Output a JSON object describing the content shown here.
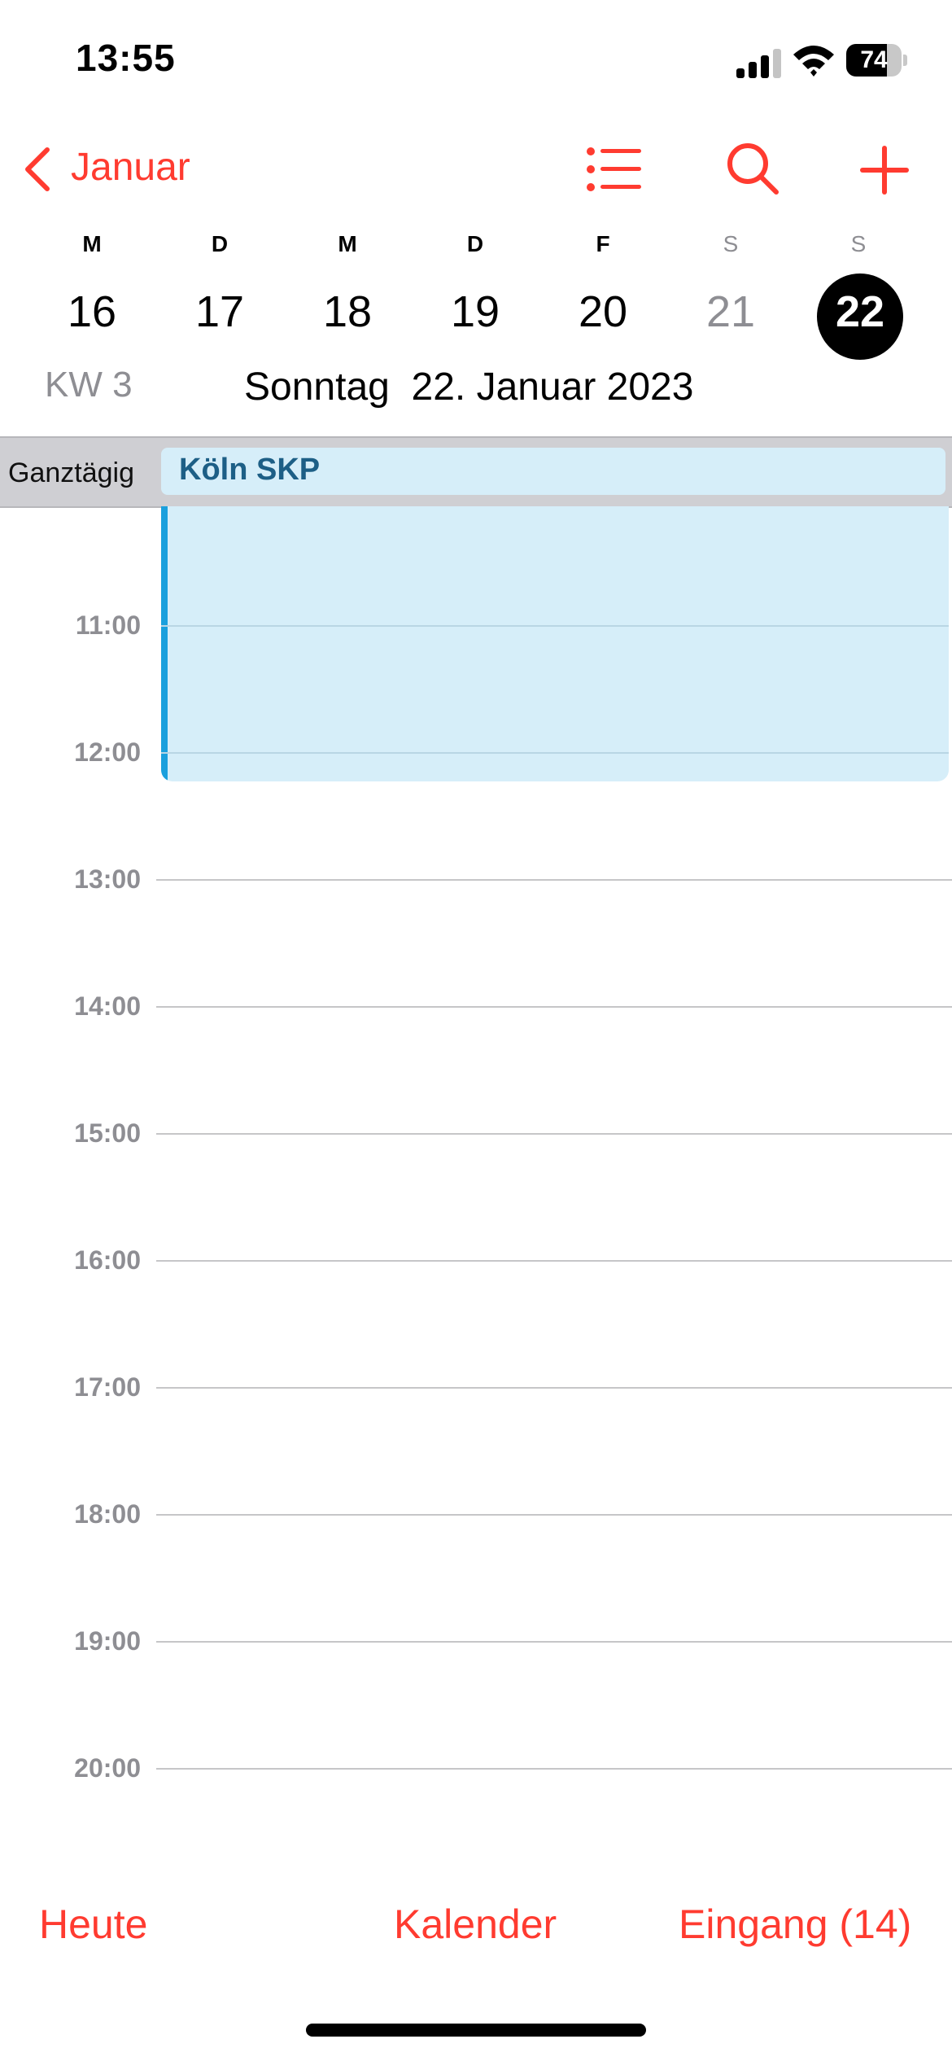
{
  "status_bar": {
    "time": "13:55",
    "battery_percent": "74",
    "battery_level": 0.74
  },
  "nav": {
    "back_label": "Januar"
  },
  "week": {
    "weekdays": [
      "M",
      "D",
      "M",
      "D",
      "F",
      "S",
      "S"
    ],
    "days": [
      "16",
      "17",
      "18",
      "19",
      "20",
      "21",
      "22"
    ],
    "selected_index": 6,
    "week_label": "KW 3",
    "date_header": "Sonntag  22. Januar 2023"
  },
  "all_day": {
    "label": "Ganztägig",
    "event_title": "Köln SKP"
  },
  "timeline": {
    "hours": [
      "11:00",
      "12:00",
      "13:00",
      "14:00",
      "15:00",
      "16:00",
      "17:00",
      "18:00",
      "19:00",
      "20:00"
    ]
  },
  "tabs": {
    "today": "Heute",
    "calendars": "Kalender",
    "inbox": "Eingang (14)"
  },
  "colors": {
    "accent": "#ff3b30",
    "event_fill": "#d6eef9",
    "event_bar": "#1aa0dd",
    "event_text": "#1d5f86"
  }
}
